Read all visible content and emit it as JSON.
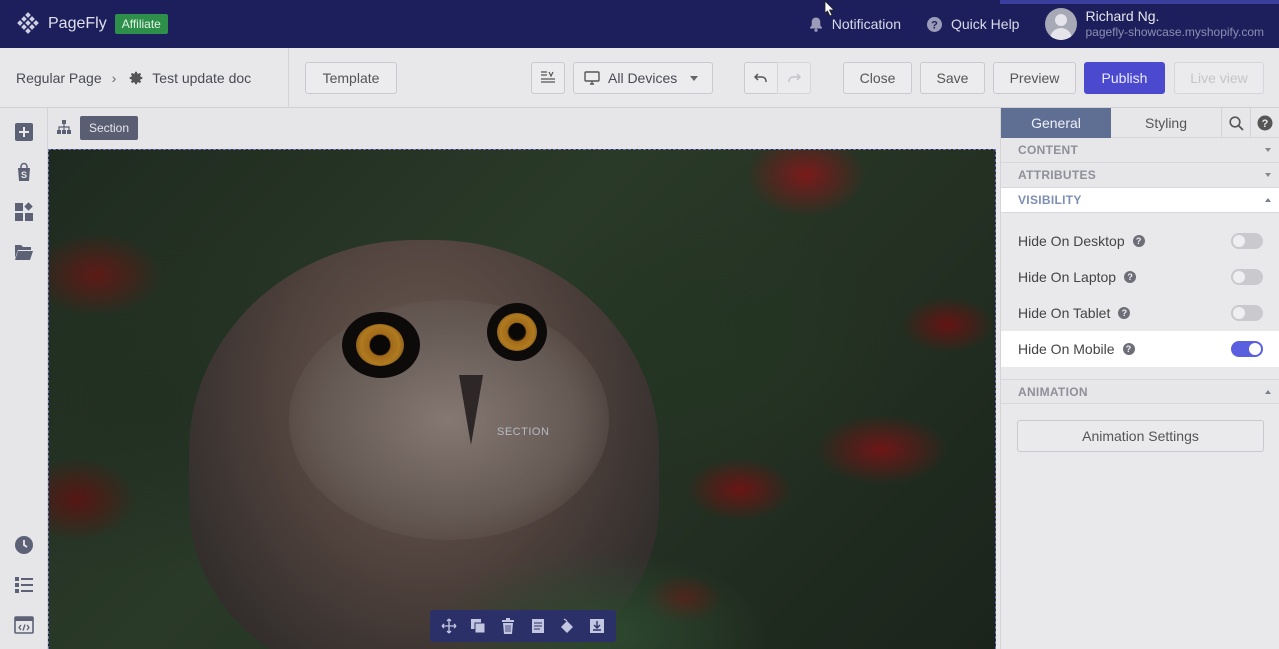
{
  "topbar": {
    "brand": "PageFly",
    "badge": "Affiliate",
    "notification": "Notification",
    "quick_help": "Quick Help",
    "user_name": "Richard Ng.",
    "user_shop": "pagefly-showcase.myshopify.com"
  },
  "toolbar": {
    "breadcrumb_root": "Regular Page",
    "breadcrumb_sep": "›",
    "doc_name": "Test update doc",
    "template": "Template",
    "device_select": "All Devices",
    "close": "Close",
    "save": "Save",
    "preview": "Preview",
    "publish": "Publish",
    "live_view": "Live view"
  },
  "canvas": {
    "selected_chip": "Section",
    "overlay_label": "SECTION"
  },
  "panel": {
    "tabs": [
      "General",
      "Styling"
    ],
    "sections": {
      "content": "CONTENT",
      "attributes": "ATTRIBUTES",
      "visibility": "VISIBILITY",
      "animation": "ANIMATION"
    },
    "visibility_rows": [
      {
        "label": "Hide On Desktop",
        "on": false
      },
      {
        "label": "Hide On Laptop",
        "on": false
      },
      {
        "label": "Hide On Tablet",
        "on": false
      },
      {
        "label": "Hide On Mobile",
        "on": true
      }
    ],
    "animation_button": "Animation Settings",
    "help_glyph": "?"
  },
  "colors": {
    "topbar": "#1c1f5c",
    "primary": "#4b4acf",
    "affiliate": "#2e8f4a",
    "active_tab": "#5f6f93",
    "toggle_on": "#5a5fe0"
  }
}
